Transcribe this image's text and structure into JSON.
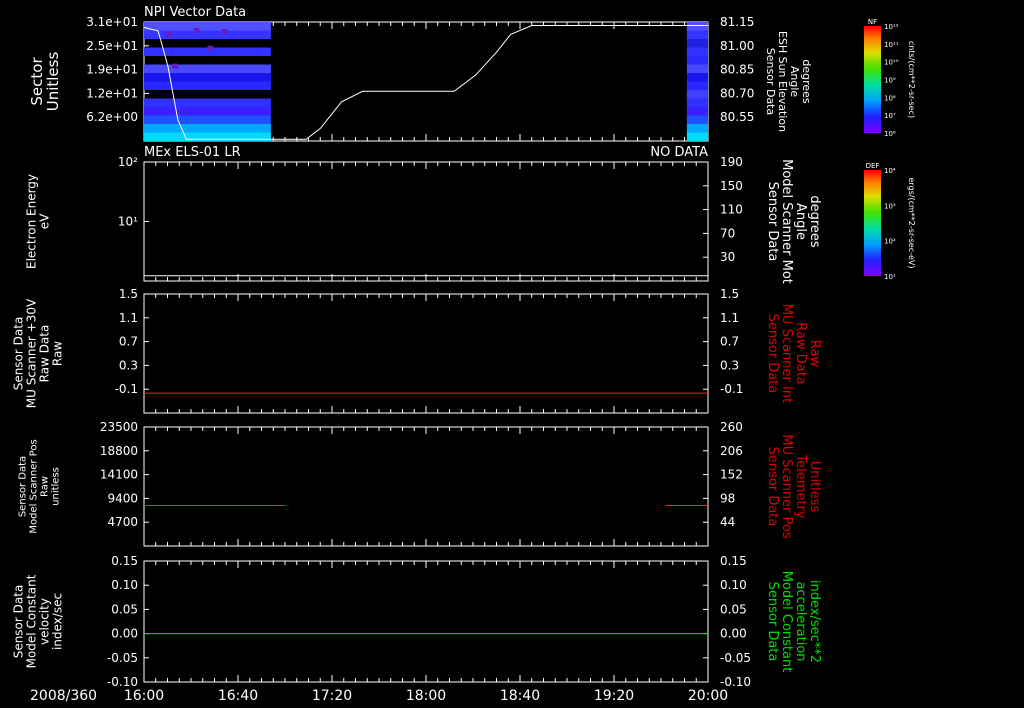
{
  "time_axis": {
    "date_label": "2008/360",
    "ticks": [
      "16:00",
      "16:40",
      "17:20",
      "18:00",
      "18:40",
      "19:20",
      "20:00"
    ]
  },
  "panels": [
    {
      "title": "NPI Vector Data",
      "left_label": [
        "Sector",
        "Unitless"
      ],
      "left_ticks": [
        "3.1e+01",
        "2.5e+01",
        "1.9e+01",
        "1.2e+01",
        "6.2e+00"
      ],
      "right_ticks": [
        "81.15",
        "81.00",
        "80.85",
        "80.70",
        "80.55"
      ],
      "right_label": [
        "Sensor Data",
        "ESH Sun Elevation",
        "Angle",
        "degrees"
      ],
      "right_label_color": "#ffffff",
      "colorbar": {
        "tag": "NF",
        "unit": "cnts/(cm**2-sr-sec)",
        "ticks": [
          "10¹²",
          "10¹¹",
          "10¹⁰",
          "10⁹",
          "10⁸",
          "10⁷",
          "10⁶"
        ]
      }
    },
    {
      "title": "MEx ELS-01 LR",
      "note": "NO DATA",
      "left_label": [
        "Electron Energy",
        "eV"
      ],
      "left_ticks": [
        "10²",
        "10¹"
      ],
      "right_ticks": [
        "190",
        "150",
        "110",
        "70",
        "30"
      ],
      "right_label": [
        "Sensor Data",
        "Model Scanner Mot",
        "Angle",
        "degrees"
      ],
      "right_label_color": "#ffffff",
      "colorbar": {
        "tag": "DEF",
        "unit": "ergs/(cm**2-sr-sec-eV)",
        "ticks": [
          "10⁴",
          "10³",
          "10²",
          "10¹"
        ]
      }
    },
    {
      "left_label": [
        "Sensor Data",
        "MU Scanner +30V",
        "Raw Data",
        "Raw"
      ],
      "left_ticks": [
        "1.5",
        "1.1",
        "0.7",
        "0.3",
        "-0.1"
      ],
      "right_ticks": [
        "1.5",
        "1.1",
        "0.7",
        "0.3",
        "-0.1"
      ],
      "right_label": [
        "Sensor Data",
        "MU Scanner Int",
        "Raw Data",
        "Raw"
      ],
      "right_label_color": "#e00000"
    },
    {
      "left_label": [
        "Sensor Data",
        "Model Scanner Pos",
        "Raw",
        "unitless"
      ],
      "left_ticks": [
        "23500",
        "18800",
        "14100",
        "9400",
        "4700"
      ],
      "right_ticks": [
        "260",
        "206",
        "152",
        "98",
        "44"
      ],
      "right_label": [
        "Sensor Data",
        "MU Scanner Pos",
        "Telemetry",
        "Unitless"
      ],
      "right_label_color": "#e00000"
    },
    {
      "left_label": [
        "Sensor Data",
        "Model Constant",
        "velocity",
        "index/sec"
      ],
      "left_ticks": [
        "0.15",
        "0.10",
        "0.05",
        "0.00",
        "-0.05",
        "-0.10"
      ],
      "right_ticks": [
        "0.15",
        "0.10",
        "0.05",
        "0.00",
        "-0.05",
        "-0.10"
      ],
      "right_label": [
        "Sensor Data",
        "Model Constant",
        "acceleration",
        "index/sec**2"
      ],
      "right_label_color": "#00e000"
    }
  ],
  "chart_data": [
    {
      "type": "heatmap",
      "title": "NPI Vector Data",
      "x_range": [
        "16:00",
        "20:00"
      ],
      "y_range": [
        0,
        31
      ],
      "data_blocks_hours": [
        [
          16.0,
          16.9
        ],
        [
          19.85,
          20.0
        ]
      ],
      "overlay_line": {
        "label": "ESH Sun Elevation Angle",
        "units": "degrees",
        "ylim": [
          80.48,
          81.15
        ],
        "x_hours": [
          16.0,
          16.1,
          16.17,
          16.24,
          16.3,
          17.15,
          17.25,
          17.4,
          17.55,
          17.7,
          18.0,
          18.2,
          18.35,
          18.5,
          18.6,
          18.75,
          20.0
        ],
        "y": [
          81.12,
          81.1,
          80.9,
          80.6,
          80.49,
          80.49,
          80.55,
          80.7,
          80.76,
          80.76,
          80.76,
          80.76,
          80.85,
          80.98,
          81.08,
          81.13,
          81.13
        ]
      }
    },
    {
      "type": "line",
      "title": "MEx ELS-01 LR",
      "ylim": [
        10,
        190
      ],
      "series": [
        {
          "x_hours": [
            16.0,
            20.0
          ],
          "values": [
            18,
            18
          ]
        }
      ]
    },
    {
      "type": "line",
      "ylim": [
        -0.3,
        1.5
      ],
      "series": [
        {
          "x_hours": [
            16.0,
            20.0
          ],
          "values": [
            0.0,
            0.0
          ]
        }
      ]
    },
    {
      "type": "line",
      "ylim": [
        0,
        23500
      ],
      "series": [
        {
          "x_hours": [
            16.0,
            17.0
          ],
          "values": [
            8000,
            8000
          ]
        },
        {
          "x_hours": [
            19.7,
            20.0
          ],
          "values": [
            8000,
            8000
          ]
        }
      ]
    },
    {
      "type": "line",
      "ylim": [
        -0.1,
        0.15
      ],
      "series": [
        {
          "x_hours": [
            16.0,
            20.0
          ],
          "values": [
            0.0,
            0.0
          ]
        }
      ]
    }
  ]
}
